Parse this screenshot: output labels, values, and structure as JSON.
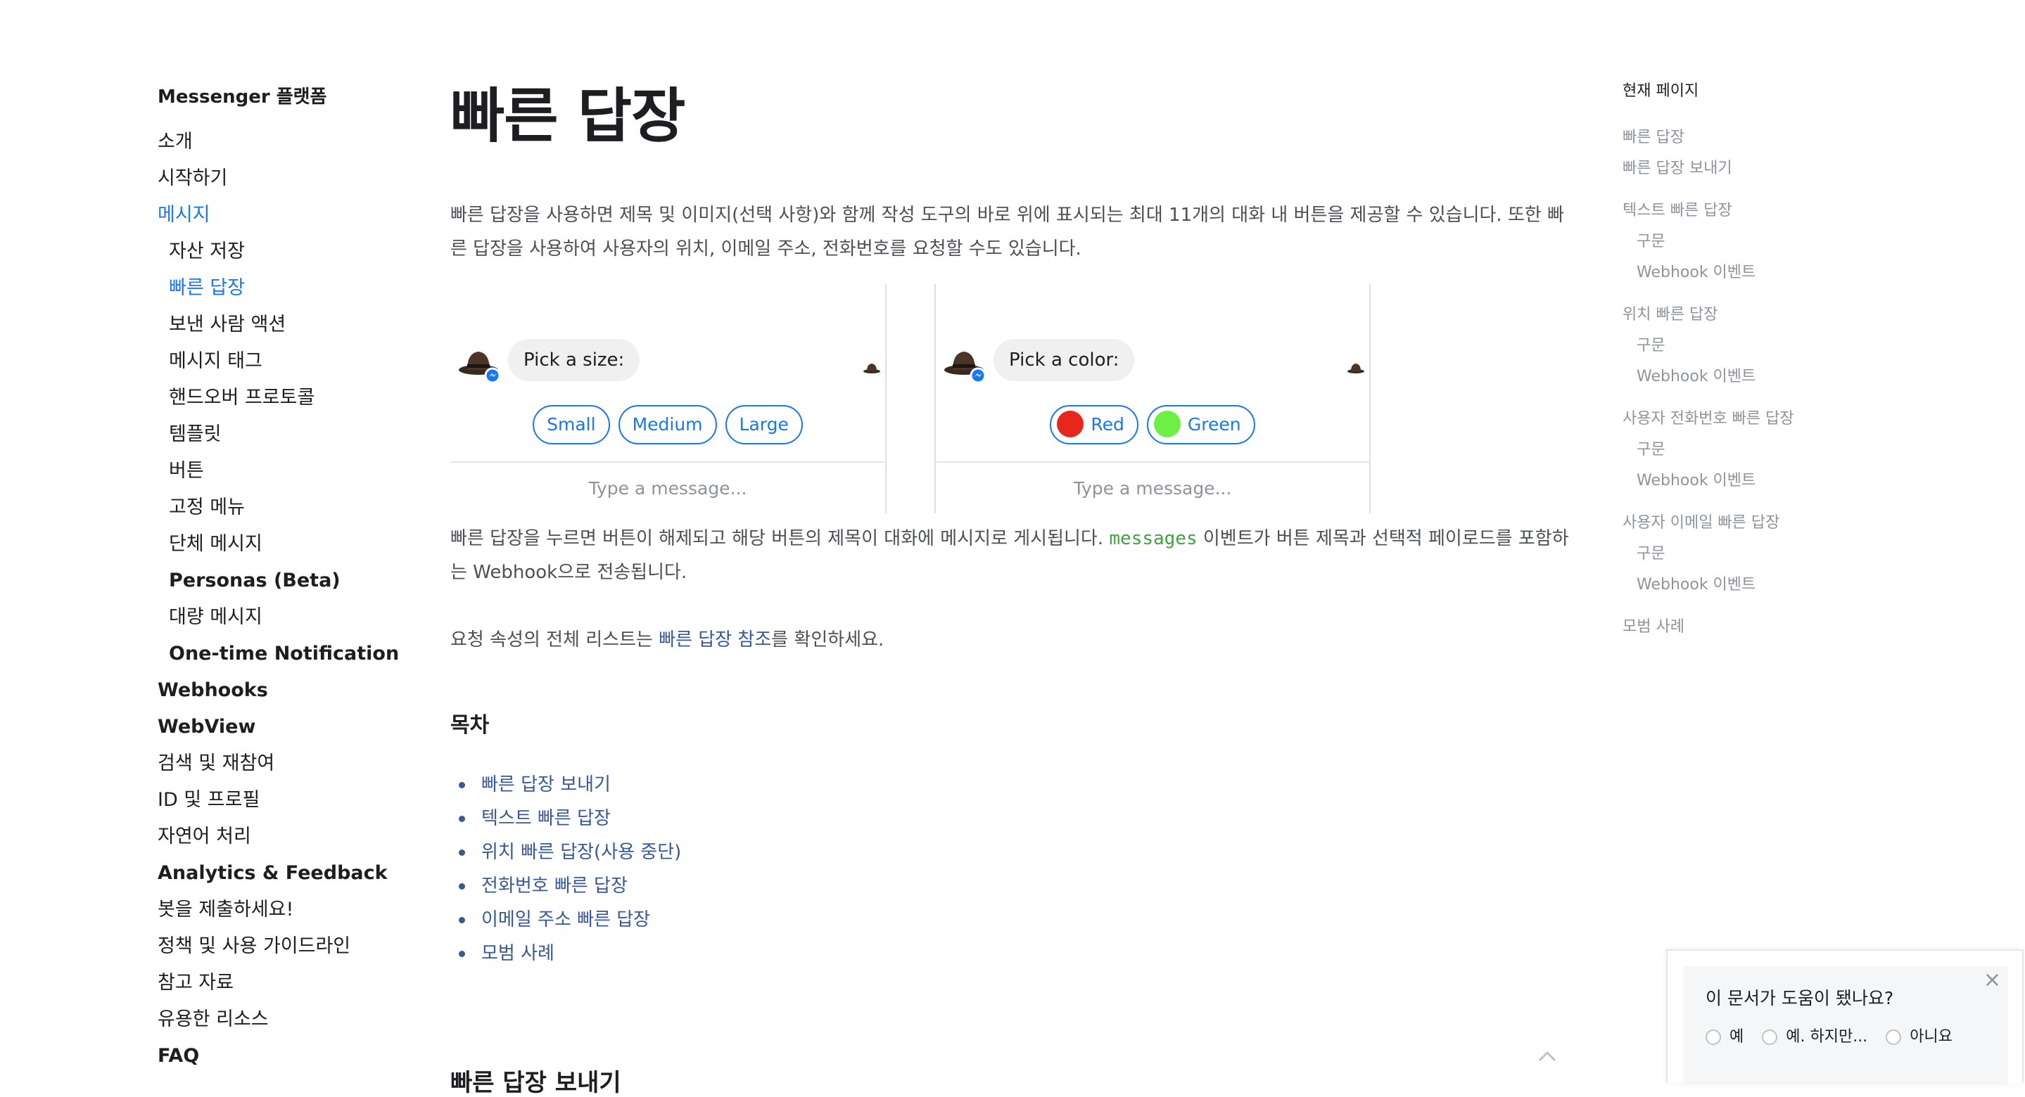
{
  "leftnav": {
    "heading": "Messenger 플랫폼",
    "items": [
      {
        "label": "소개",
        "level": 0
      },
      {
        "label": "시작하기",
        "level": 0
      },
      {
        "label": "메시지",
        "level": 0,
        "active": true
      },
      {
        "label": "자산 저장",
        "level": 1
      },
      {
        "label": "빠른 답장",
        "level": 1,
        "active": true
      },
      {
        "label": "보낸 사람 액션",
        "level": 1
      },
      {
        "label": "메시지 태그",
        "level": 1
      },
      {
        "label": "핸드오버 프로토콜",
        "level": 1
      },
      {
        "label": "템플릿",
        "level": 1
      },
      {
        "label": "버튼",
        "level": 1
      },
      {
        "label": "고정 메뉴",
        "level": 1
      },
      {
        "label": "단체 메시지",
        "level": 1
      },
      {
        "label": "Personas (Beta)",
        "level": 1,
        "bold": true
      },
      {
        "label": "대량 메시지",
        "level": 1
      },
      {
        "label": "One-time Notification",
        "level": 1,
        "bold": true
      },
      {
        "label": "Webhooks",
        "level": 0,
        "bold": true
      },
      {
        "label": "WebView",
        "level": 0,
        "bold": true
      },
      {
        "label": "검색 및 재참여",
        "level": 0
      },
      {
        "label": "ID 및 프로필",
        "level": 0
      },
      {
        "label": "자연어 처리",
        "level": 0
      },
      {
        "label": "Analytics & Feedback",
        "level": 0,
        "bold": true
      },
      {
        "label": "봇을 제출하세요!",
        "level": 0
      },
      {
        "label": "정책 및 사용 가이드라인",
        "level": 0
      },
      {
        "label": "참고 자료",
        "level": 0
      },
      {
        "label": "유용한 리소스",
        "level": 0
      },
      {
        "label": "FAQ",
        "level": 0,
        "bold": true
      }
    ]
  },
  "main": {
    "title": "빠른 답장",
    "intro": "빠른 답장을 사용하면 제목 및 이미지(선택 사항)와 함께 작성 도구의 바로 위에 표시되는 최대 11개의 대화 내 버튼을 제공할 수 있습니다. 또한 빠른 답장을 사용하여 사용자의 위치, 이메일 주소, 전화번호를 요청할 수도 있습니다.",
    "demo_left": {
      "prompt": "Pick a size:",
      "replies": [
        {
          "label": "Small"
        },
        {
          "label": "Medium"
        },
        {
          "label": "Large"
        }
      ],
      "composer_placeholder": "Type a message..."
    },
    "demo_right": {
      "prompt": "Pick a color:",
      "replies": [
        {
          "label": "Red",
          "color": "#e8271c"
        },
        {
          "label": "Green",
          "color": "#6cf046"
        }
      ],
      "composer_placeholder": "Type a message..."
    },
    "para1_before": "빠른 답장을 누르면 버튼이 해제되고 해당 버튼의 제목이 대화에 메시지로 게시됩니다. ",
    "para1_code": "messages",
    "para1_after": " 이벤트가 버튼 제목과 선택적 페이로드를 포함하는 Webhook으로 전송됩니다.",
    "para2_before": "요청 속성의 전체 리스트는 ",
    "para2_link": "빠른 답장 참조",
    "para2_after": "를 확인하세요.",
    "toc_title": "목차",
    "toc": [
      {
        "label": "빠른 답장 보내기"
      },
      {
        "label": "텍스트 빠른 답장"
      },
      {
        "label": "위치 빠른 답장(사용 중단)"
      },
      {
        "label": "전화번호 빠른 답장"
      },
      {
        "label": "이메일 주소 빠른 답장"
      },
      {
        "label": "모범 사례"
      }
    ],
    "next_heading": "빠른 답장 보내기"
  },
  "righttoc": {
    "heading": "현재 페이지",
    "items": [
      {
        "label": "빠른 답장",
        "level": 0
      },
      {
        "label": "빠른 답장 보내기",
        "level": 0
      },
      {
        "label": "텍스트 빠른 답장",
        "level": 0
      },
      {
        "label": "구문",
        "level": 1
      },
      {
        "label": "Webhook 이벤트",
        "level": 1
      },
      {
        "label": "위치 빠른 답장",
        "level": 0
      },
      {
        "label": "구문",
        "level": 1
      },
      {
        "label": "Webhook 이벤트",
        "level": 1
      },
      {
        "label": "사용자 전화번호 빠른 답장",
        "level": 0
      },
      {
        "label": "구문",
        "level": 1
      },
      {
        "label": "Webhook 이벤트",
        "level": 1
      },
      {
        "label": "사용자 이메일 빠른 답장",
        "level": 0
      },
      {
        "label": "구문",
        "level": 1
      },
      {
        "label": "Webhook 이벤트",
        "level": 1
      },
      {
        "label": "모범 사례",
        "level": 0
      }
    ]
  },
  "feedback": {
    "question": "이 문서가 도움이 됐나요?",
    "options": [
      {
        "label": "예"
      },
      {
        "label": "예. 하지만..."
      },
      {
        "label": "아니요"
      }
    ]
  },
  "colors": {
    "link_blue": "#385898",
    "active_blue": "#1877f2",
    "code_green": "#42a242",
    "muted_gray": "#8d949e"
  }
}
